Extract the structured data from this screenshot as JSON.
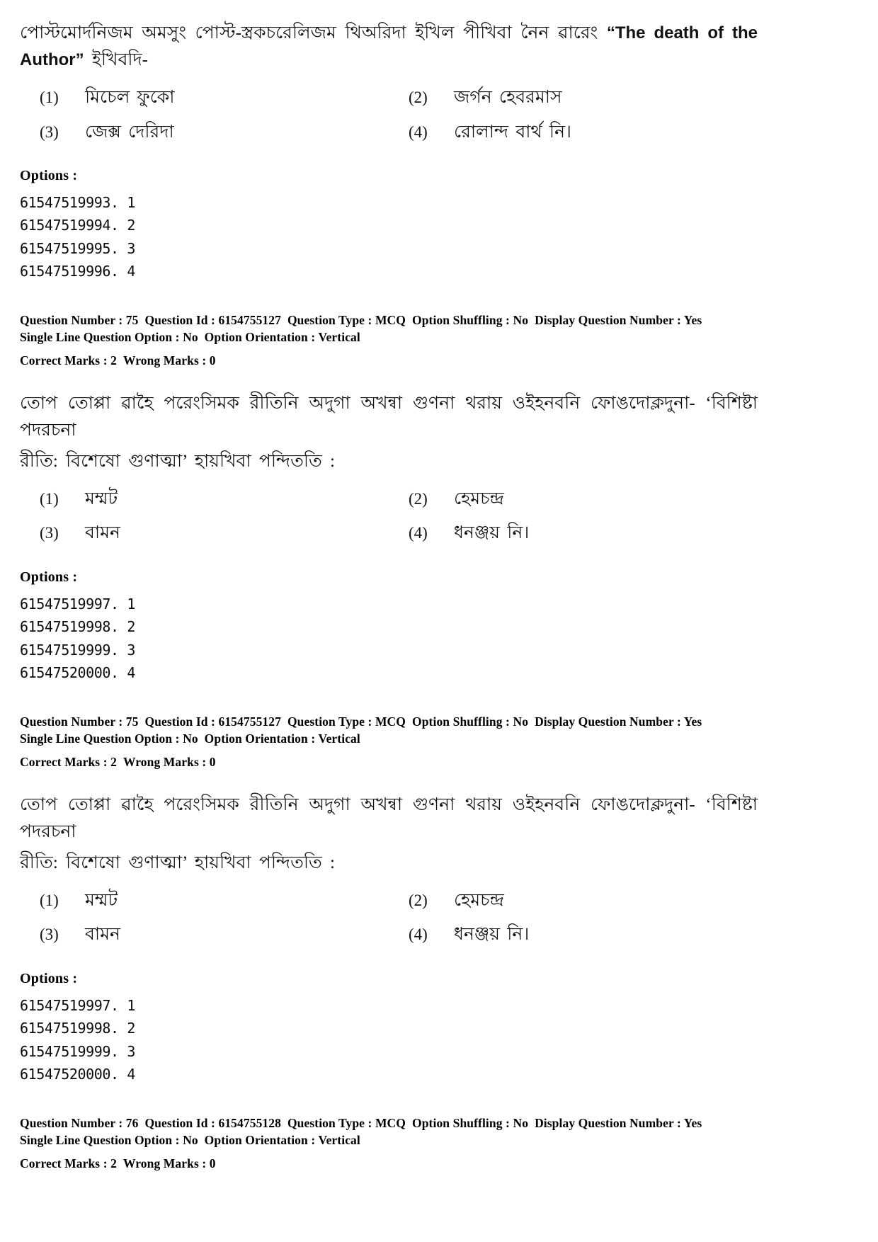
{
  "page": {
    "document_type": "exam-question-paper",
    "language_script": "Bengali/Meitei"
  },
  "questions": [
    {
      "id": "q74",
      "stem_lines": [
        "পোস্টমোর্দনিজম অমসুং পোস্ট-স্ত্রকচরেলিজম থিঅরিদা ইখিল পীখিবা নৈন ৱারেং ",
        " ইখিবদি-"
      ],
      "stem_latin": "“The death of the Author”",
      "choices": [
        {
          "num": "(1)",
          "text": "মিচেল ফুকো"
        },
        {
          "num": "(2)",
          "text": "জর্গন হেবরমাস"
        },
        {
          "num": "(3)",
          "text": "জেক্স দেরিদা"
        },
        {
          "num": "(4)",
          "text": "রোলান্দ বার্থ    নি।"
        }
      ],
      "options_label": "Options :",
      "option_ids": [
        "61547519993. 1",
        "61547519994. 2",
        "61547519995. 3",
        "61547519996. 4"
      ]
    },
    {
      "id": "q75a",
      "stem_lines": [
        "তোপ তোপ্পা ৱাহৈ পরেংসিমক রীতিনি অদুগা অখন্বা গুণনা থরায় ওইহনবনি ফোঙদোক্লদুনা- ‘বিশিষ্টা পদরচনা",
        "রীতি: বিশেষো গুণাত্মা’ হায়খিবা পন্দিততি :"
      ],
      "choices": [
        {
          "num": "(1)",
          "text": "মম্মট"
        },
        {
          "num": "(2)",
          "text": "হেমচন্দ্র"
        },
        {
          "num": "(3)",
          "text": "বামন"
        },
        {
          "num": "(4)",
          "text": "ধনঞ্জয়    নি।"
        }
      ],
      "options_label": "Options :",
      "option_ids": [
        "61547519997. 1",
        "61547519998. 2",
        "61547519999. 3",
        "61547520000. 4"
      ]
    },
    {
      "id": "q75b",
      "stem_lines": [
        "তোপ তোপ্পা ৱাহৈ পরেংসিমক রীতিনি অদুগা অখন্বা গুণনা থরায় ওইহনবনি ফোঙদোক্লদুনা- ‘বিশিষ্টা পদরচনা",
        "রীতি: বিশেষো গুণাত্মা’ হায়খিবা পন্দিততি :"
      ],
      "choices": [
        {
          "num": "(1)",
          "text": "মম্মট"
        },
        {
          "num": "(2)",
          "text": "হেমচন্দ্র"
        },
        {
          "num": "(3)",
          "text": "বামন"
        },
        {
          "num": "(4)",
          "text": "ধনঞ্জয়    নি।"
        }
      ],
      "options_label": "Options :",
      "option_ids": [
        "61547519997. 1",
        "61547519998. 2",
        "61547519999. 3",
        "61547520000. 4"
      ]
    }
  ],
  "meta_blocks": [
    {
      "id": "meta75-1",
      "question_number_label": "Question Number :",
      "question_number": "75",
      "question_id_label": "Question Id :",
      "question_id": "6154755127",
      "question_type_label": "Question Type :",
      "question_type": "MCQ",
      "option_shuffling_label": "Option Shuffling :",
      "option_shuffling": "No",
      "display_question_number_label": "Display Question Number :",
      "display_question_number": "Yes",
      "single_line_label": "Single Line Question Option :",
      "single_line": "No",
      "option_orientation_label": "Option Orientation :",
      "option_orientation": "Vertical",
      "correct_marks_label": "Correct Marks :",
      "correct_marks": "2",
      "wrong_marks_label": "Wrong Marks :",
      "wrong_marks": "0"
    },
    {
      "id": "meta75-2",
      "question_number_label": "Question Number :",
      "question_number": "75",
      "question_id_label": "Question Id :",
      "question_id": "6154755127",
      "question_type_label": "Question Type :",
      "question_type": "MCQ",
      "option_shuffling_label": "Option Shuffling :",
      "option_shuffling": "No",
      "display_question_number_label": "Display Question Number :",
      "display_question_number": "Yes",
      "single_line_label": "Single Line Question Option :",
      "single_line": "No",
      "option_orientation_label": "Option Orientation :",
      "option_orientation": "Vertical",
      "correct_marks_label": "Correct Marks :",
      "correct_marks": "2",
      "wrong_marks_label": "Wrong Marks :",
      "wrong_marks": "0"
    },
    {
      "id": "meta76",
      "question_number_label": "Question Number :",
      "question_number": "76",
      "question_id_label": "Question Id :",
      "question_id": "6154755128",
      "question_type_label": "Question Type :",
      "question_type": "MCQ",
      "option_shuffling_label": "Option Shuffling :",
      "option_shuffling": "No",
      "display_question_number_label": "Display Question Number :",
      "display_question_number": "Yes",
      "single_line_label": "Single Line Question Option :",
      "single_line": "No",
      "option_orientation_label": "Option Orientation :",
      "option_orientation": "Vertical",
      "correct_marks_label": "Correct Marks :",
      "correct_marks": "2",
      "wrong_marks_label": "Wrong Marks :",
      "wrong_marks": "0"
    }
  ]
}
